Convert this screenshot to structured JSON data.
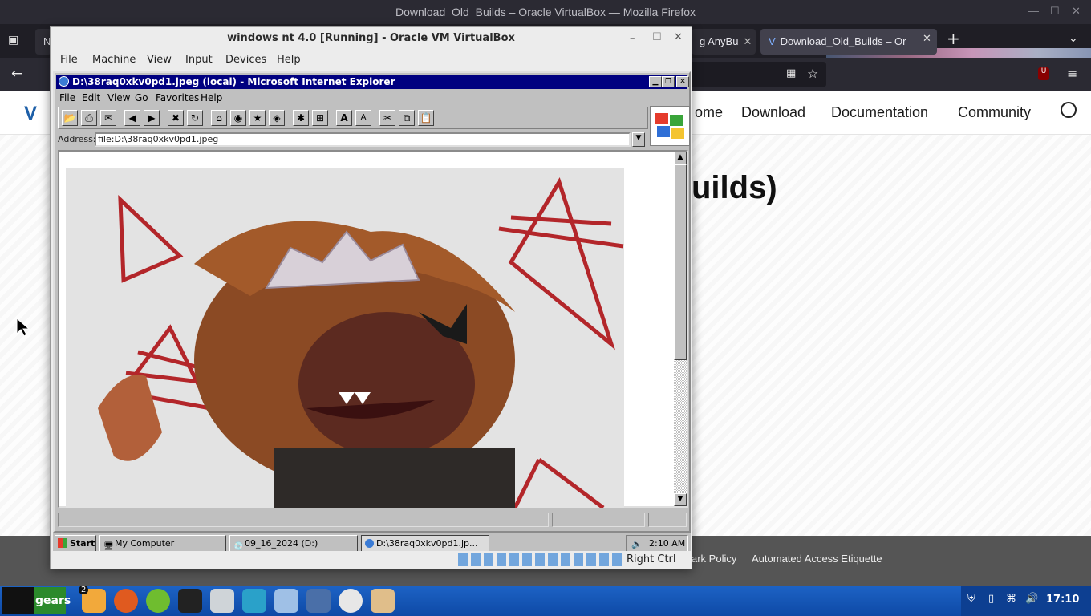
{
  "firefox": {
    "window_title": "Download_Old_Builds – Oracle VirtualBox — Mozilla Firefox",
    "tabs": [
      {
        "label": "N"
      },
      {
        "label": "g AnyBu"
      },
      {
        "label": "Download_Old_Builds – Or"
      }
    ],
    "new_tab": "+",
    "icons": [
      "tab-list-icon",
      "back-icon",
      "extensions-icon",
      "bookmark-star-icon",
      "ublock-icon",
      "menu-icon",
      "account-icon"
    ]
  },
  "site": {
    "nav": {
      "home_partial": "ome",
      "download": "Download",
      "documentation": "Documentation",
      "community": "Community"
    },
    "title_partial": "uilds)",
    "footer": {
      "policy_partial": "ark Policy",
      "etiquette": "Automated Access Etiquette"
    }
  },
  "vbox": {
    "title": "windows nt 4.0 [Running] - Oracle VM VirtualBox",
    "menu": {
      "machine_label": "Machine",
      "view_label": "View",
      "input_label": "Input",
      "devices_label": "Devices",
      "help_label": "Help",
      "file_label": "File"
    },
    "host_key": "Right Ctrl"
  },
  "ie": {
    "title": "D:\\38raq0xkv0pd1.jpeg (local) - Microsoft Internet Explorer",
    "menu": {
      "file": "File",
      "edit": "Edit",
      "view": "View",
      "go": "Go",
      "favorites": "Favorites",
      "help": "Help"
    },
    "address_label": "Address:",
    "address_value": "file:D:\\38raq0xkv0pd1.jpeg"
  },
  "win_taskbar": {
    "start": "Start",
    "items": [
      {
        "label": "My Computer"
      },
      {
        "label": "09_16_2024 (D:)"
      },
      {
        "label": "D:\\38raq0xkv0pd1.jp..."
      }
    ],
    "clock": "2:10 AM"
  },
  "linux_panel": {
    "menu_label": "gears",
    "badge": "2",
    "clock": "17:10"
  }
}
